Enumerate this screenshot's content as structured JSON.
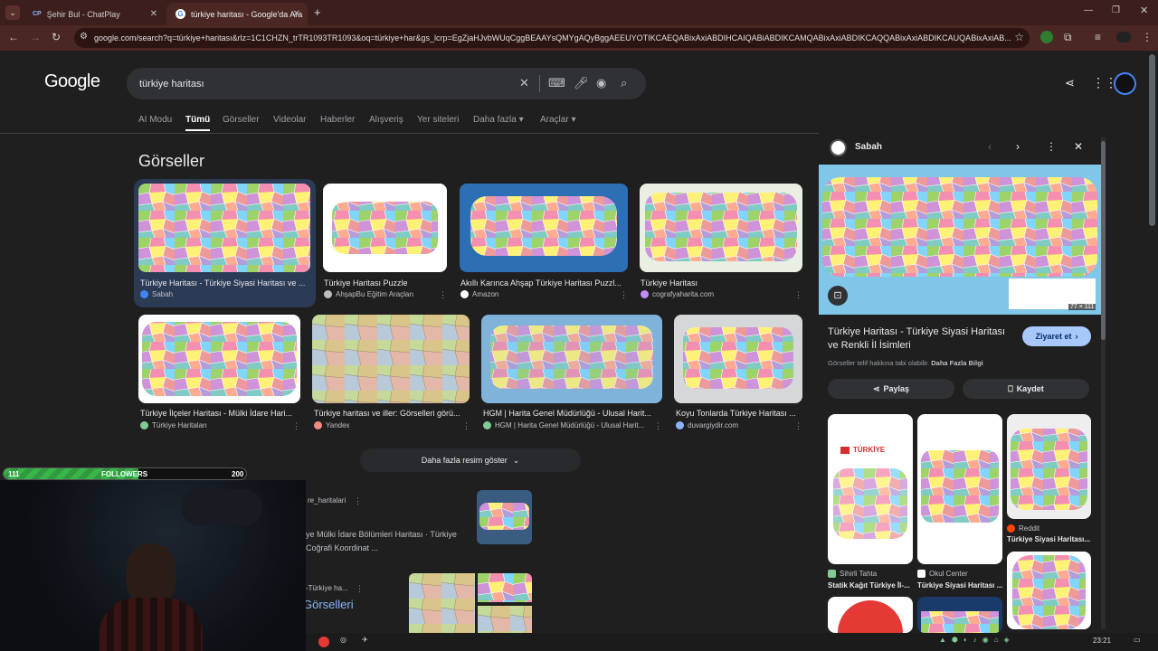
{
  "browser": {
    "tabs": [
      {
        "title": "Şehir Bul - ChatPlay",
        "icon": "CP"
      },
      {
        "title": "türkiye haritası - Google'da Ara",
        "icon": "G"
      }
    ],
    "new_tab": "+",
    "url": "google.com/search?q=türkiye+haritası&rlz=1C1CHZN_trTR1093TR1093&oq=türkiye+har&gs_lcrp=EgZjaHJvbWUqCggBEAAYsQMYgAQyBggAEEUYOTIKCAEQABixAxiABDIHCAIQABiABDIKCAMQABixAxiABDIKCAQQABixAxiABDIKCAUQABixAxiAB..."
  },
  "google": {
    "logo": "Google",
    "query": "türkiye haritası",
    "tabs": [
      "AI Modu",
      "Tümü",
      "Görseller",
      "Videolar",
      "Haberler",
      "Alışveriş",
      "Yer siteleri",
      "Daha fazla",
      "Araçlar"
    ],
    "images_heading": "Görseller",
    "images": [
      {
        "caption": "Türkiye Haritası - Türkiye Siyasi Haritası ve ...",
        "source": "Sabah",
        "color": "#4285f4"
      },
      {
        "caption": "Türkiye Haritası Puzzle",
        "source": "AhşapBu Eğitim Araçları",
        "color": "#bdbdbd"
      },
      {
        "caption": "Akıllı Karınca Ahşap Türkiye Haritası Puzzl...",
        "source": "Amazon",
        "color": "#ffffff"
      },
      {
        "caption": "Türkiye Haritası",
        "source": "cografyaharita.com",
        "color": "#c58af9"
      },
      {
        "caption": "Türkiye İlçeler Haritası - Mülki İdare Hari...",
        "source": "Türkiye Haritaları",
        "color": "#81c995"
      },
      {
        "caption": "Türkiye haritası ve iller: Görselleri görü...",
        "source": "Yandex",
        "color": "#f28b82"
      },
      {
        "caption": "HGM | Harita Genel Müdürlüğü - Ulusal Harit...",
        "source": "HGM | Harita Genel Müdürlüğü - Ulusal Harit...",
        "color": "#81c995"
      },
      {
        "caption": "Koyu Tonlarda Türkiye Haritası ...",
        "source": "duvargiydir.com",
        "color": "#8ab4f8"
      }
    ],
    "more_images": "Daha fazla resim göster",
    "result1": {
      "source": "re_haritalari",
      "text1": "ye Mülki İdare Bölümleri Haritası · Türkiye",
      "text2": "Coğrafi Koordinat ..."
    },
    "result2": {
      "source": "-Türkiye ha...",
      "title": "Görselleri"
    }
  },
  "panel": {
    "source": "Sabah",
    "title": "Türkiye Haritası - Türkiye Siyasi Haritası ve Renkli İl İsimleri",
    "visit": "Ziyaret et",
    "copyright_text": "Görseller telif hakkına tabi olabilir.",
    "copyright_link": "Daha Fazla Bilgi",
    "share": "Paylaş",
    "save": "Kaydet",
    "size": "77 × 111",
    "related": [
      {
        "source": "Sihirli Tahta",
        "caption": "Statik Kağıt Türkiye İl-...",
        "label": "TÜRKİYE"
      },
      {
        "source": "Okul Center",
        "caption": "Türkiye Siyasi Haritası ..."
      },
      {
        "source": "Reddit",
        "caption": "Türkiye Siyasi Haritası..."
      }
    ]
  },
  "overlay": {
    "followers_label": "FOLLOWERS",
    "followers_current": "111",
    "followers_goal": "200",
    "followers_fraction": 0.555
  },
  "taskbar": {
    "time": "23:21"
  }
}
